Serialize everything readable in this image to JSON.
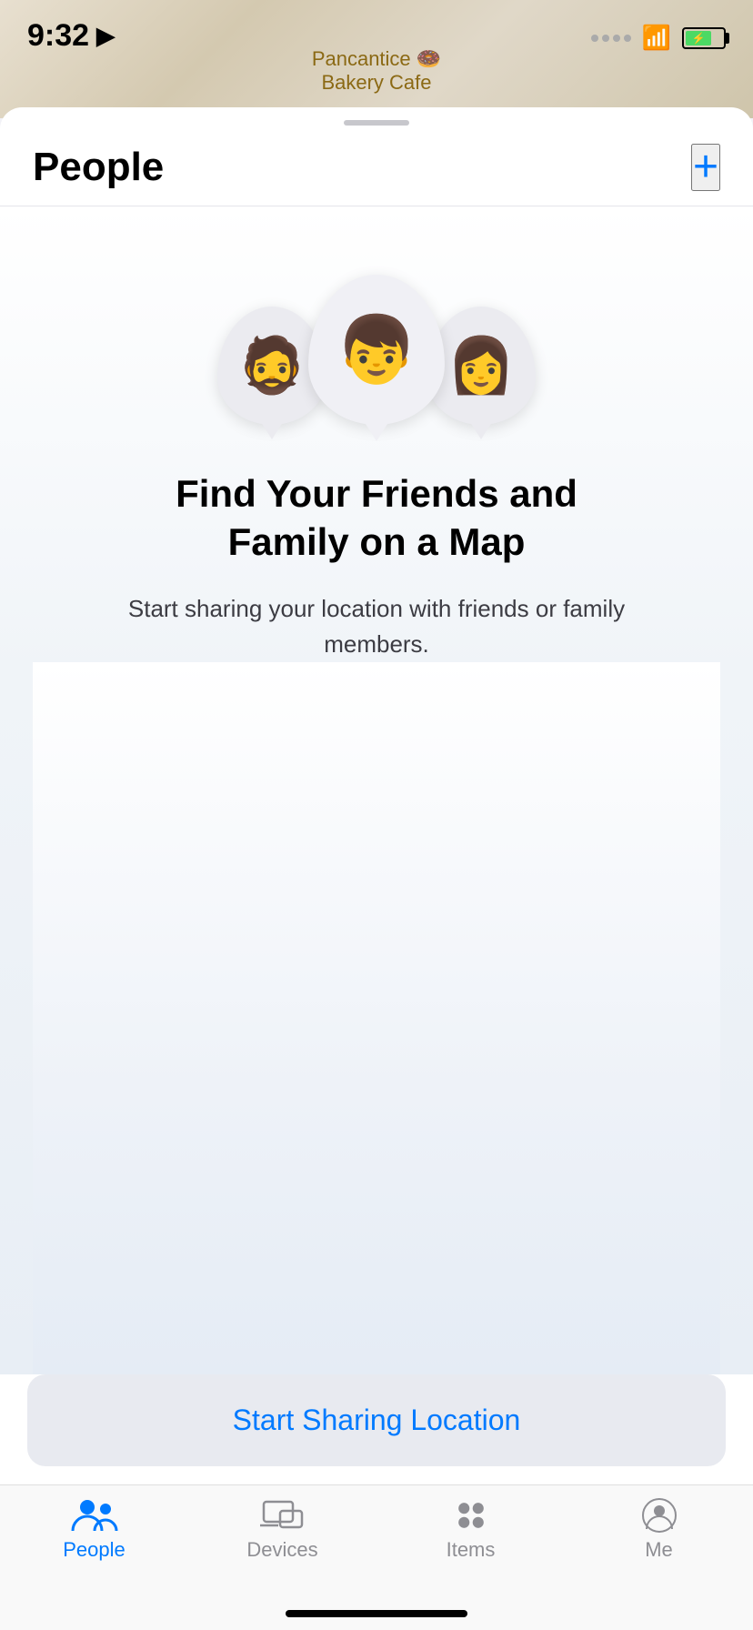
{
  "statusBar": {
    "time": "9:32",
    "locationArrow": "➤"
  },
  "mapLabel": "Pancantice\nBakery Cafe",
  "sheetHandle": "",
  "header": {
    "title": "People",
    "addButton": "+"
  },
  "avatars": [
    {
      "emoji": "🧔",
      "position": "left"
    },
    {
      "emoji": "👦",
      "position": "center"
    },
    {
      "emoji": "👩‍🦯",
      "position": "right"
    }
  ],
  "mainTitle": "Find Your Friends and Family on a Map",
  "subText": "Start sharing your location with friends or family members.",
  "startSharingButton": "Start Sharing Location",
  "tabs": [
    {
      "id": "people",
      "label": "People",
      "active": true
    },
    {
      "id": "devices",
      "label": "Devices",
      "active": false
    },
    {
      "id": "items",
      "label": "Items",
      "active": false
    },
    {
      "id": "me",
      "label": "Me",
      "active": false
    }
  ]
}
